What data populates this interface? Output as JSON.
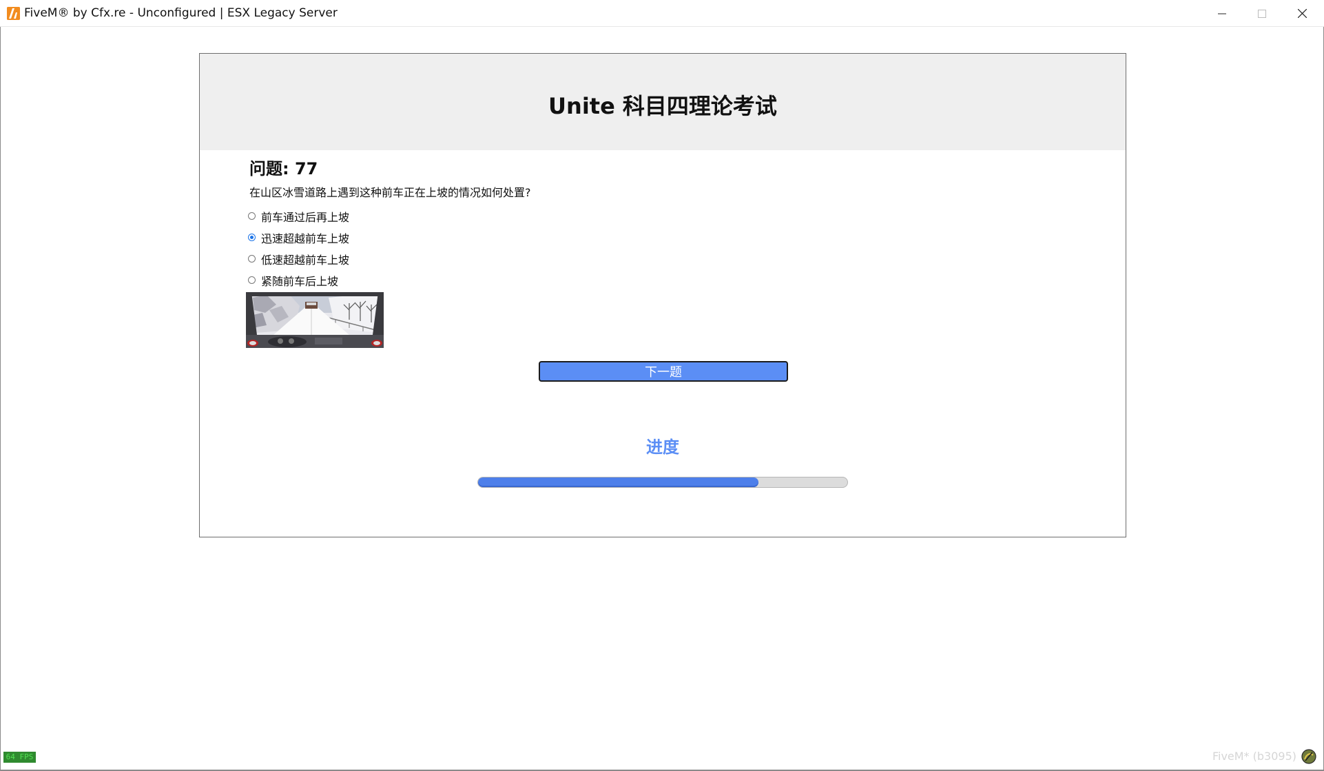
{
  "window": {
    "title": "FiveM® by Cfx.re - Unconfigured | ESX Legacy Server",
    "app_icon": "fivem-logo-icon",
    "controls": [
      "minimize-icon",
      "maximize-icon",
      "close-icon"
    ]
  },
  "exam": {
    "title": "Unite 科目四理论考试",
    "question_number_label": "问题: 77",
    "question_text": "在山区冰雪道路上遇到这种前车正在上坡的情况如何处置?",
    "options": [
      {
        "label": "前车通过后再上坡",
        "selected": false
      },
      {
        "label": "迅速超越前车上坡",
        "selected": true
      },
      {
        "label": "低速超越前车上坡",
        "selected": false
      },
      {
        "label": "紧随前车后上坡",
        "selected": false
      }
    ],
    "next_button_label": "下一题",
    "progress_label": "进度",
    "progress_fraction": 0.76
  },
  "overlay": {
    "fps_text": "64 FPS",
    "watermark": "FiveM* (b3095)",
    "watermark_icon": "fivem-badge-icon"
  },
  "colors": {
    "accent": "#5b8ef5",
    "progress_fill": "#4d7fea",
    "header_bg": "#efefef"
  }
}
